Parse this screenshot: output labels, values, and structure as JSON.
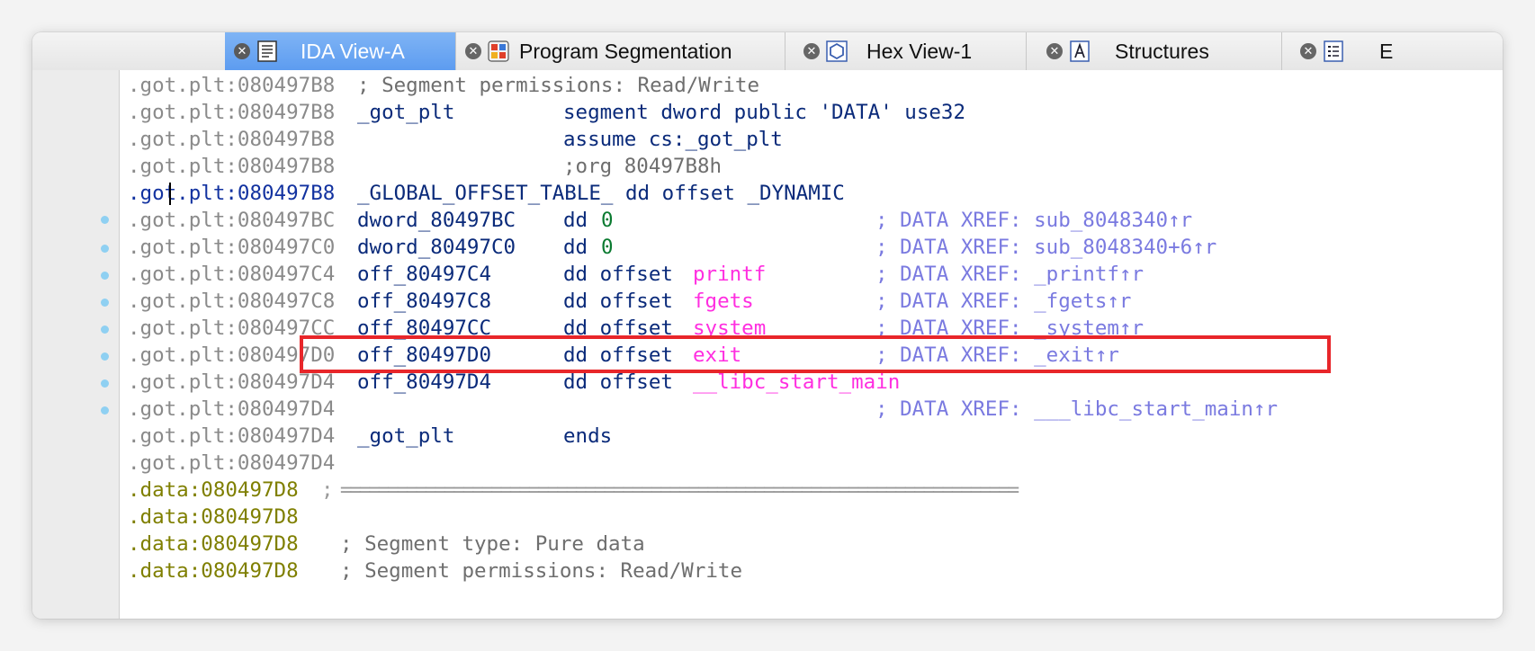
{
  "tabs": [
    {
      "label": "IDA View-A",
      "icon": "ida-view-icon",
      "active": true
    },
    {
      "label": "Program Segmentation",
      "icon": "segmentation-icon",
      "active": false
    },
    {
      "label": "Hex View-1",
      "icon": "hex-view-icon",
      "active": false
    },
    {
      "label": "Structures",
      "icon": "structures-icon",
      "active": false
    },
    {
      "label": "E",
      "icon": "enums-icon",
      "active": false
    }
  ],
  "close_glyph": "✕",
  "lines": [
    {
      "addr": ".got.plt:080497B8",
      "text": "; Segment permissions: Read/Write"
    },
    {
      "addr": ".got.plt:080497B8",
      "name": "_got_plt",
      "instr": "segment dword public 'DATA' use32"
    },
    {
      "addr": ".got.plt:080497B8",
      "instr": "assume cs:_got_plt"
    },
    {
      "addr": ".got.plt:080497B8",
      "instr": ";org 80497B8h"
    },
    {
      "addr": ".got.plt:080497B8",
      "text": "_GLOBAL_OFFSET_TABLE_ dd offset _DYNAMIC"
    },
    {
      "addr": ".got.plt:080497BC",
      "name": "dword_80497BC",
      "instr": "dd",
      "value": "0",
      "comment": "; DATA XREF: sub_8048340↑r"
    },
    {
      "addr": ".got.plt:080497C0",
      "name": "dword_80497C0",
      "instr": "dd",
      "value": "0",
      "comment": "; DATA XREF: sub_8048340+6↑r"
    },
    {
      "addr": ".got.plt:080497C4",
      "name": "off_80497C4",
      "instr": "dd offset",
      "value": "printf",
      "comment": "; DATA XREF: _printf↑r"
    },
    {
      "addr": ".got.plt:080497C8",
      "name": "off_80497C8",
      "instr": "dd offset",
      "value": "fgets",
      "comment": "; DATA XREF: _fgets↑r"
    },
    {
      "addr": ".got.plt:080497CC",
      "name": "off_80497CC",
      "instr": "dd offset",
      "value": "system",
      "comment": "; DATA XREF: _system↑r"
    },
    {
      "addr": ".got.plt:080497D0",
      "name": "off_80497D0",
      "instr": "dd offset",
      "value": "exit",
      "comment": "; DATA XREF: _exit↑r"
    },
    {
      "addr": ".got.plt:080497D4",
      "name": "off_80497D4",
      "instr": "dd offset",
      "value": "__libc_start_main"
    },
    {
      "addr": ".got.plt:080497D4",
      "comment": "; DATA XREF: ___libc_start_main↑r"
    },
    {
      "addr": ".got.plt:080497D4",
      "name": "_got_plt",
      "instr": "ends"
    },
    {
      "addr": ".got.plt:080497D4"
    },
    {
      "addr": ".data:080497D8",
      "separator": "; ========================================================================"
    },
    {
      "addr": ".data:080497D8"
    },
    {
      "addr": ".data:080497D8",
      "text": "; Segment type: Pure data"
    },
    {
      "addr": ".data:080497D8",
      "text": "; Segment permissions: Read/Write"
    }
  ],
  "colors": {
    "active_tab": "#6aa6f3",
    "highlight_border": "#e8262a",
    "import_name": "#ff2ee0",
    "comment": "#7a7ae0",
    "number": "#0a7a30"
  }
}
